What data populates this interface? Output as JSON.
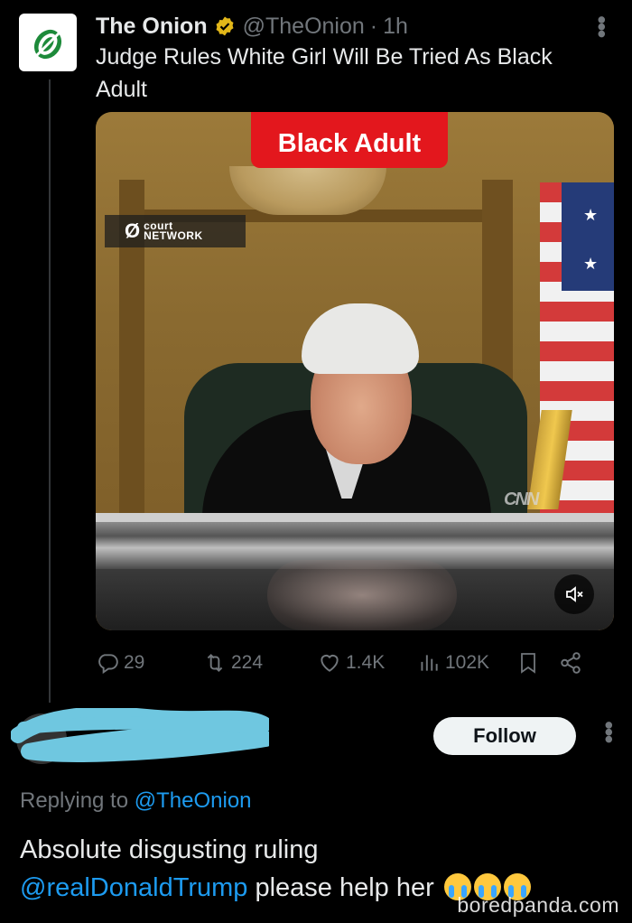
{
  "tweet": {
    "display_name": "The Onion",
    "handle": "@TheOnion",
    "separator": "·",
    "time": "1h",
    "text": "Judge Rules White Girl Will Be Tried As Black Adult",
    "media": {
      "caption": "Black Adult",
      "watermark_top": "court",
      "watermark_bottom": "NETWORK",
      "corner_logo": "CNN"
    },
    "stats": {
      "replies": "29",
      "reposts": "224",
      "likes": "1.4K",
      "views": "102K"
    },
    "colors": {
      "verified": "#e2b719",
      "accent": "#1d9bf0"
    },
    "icons": [
      "onion-logo-icon",
      "verified-badge-icon",
      "more-icon",
      "mute-icon",
      "reply-icon",
      "repost-icon",
      "like-icon",
      "views-icon",
      "bookmark-icon",
      "share-icon"
    ]
  },
  "reply": {
    "follow_label": "Follow",
    "replying_prefix": "Replying to",
    "replying_handle": "@TheOnion",
    "line1": "Absolute disgusting ruling",
    "mention": "@realDonaldTrump",
    "line2": "please help her"
  },
  "watermark": "boredpanda.com"
}
